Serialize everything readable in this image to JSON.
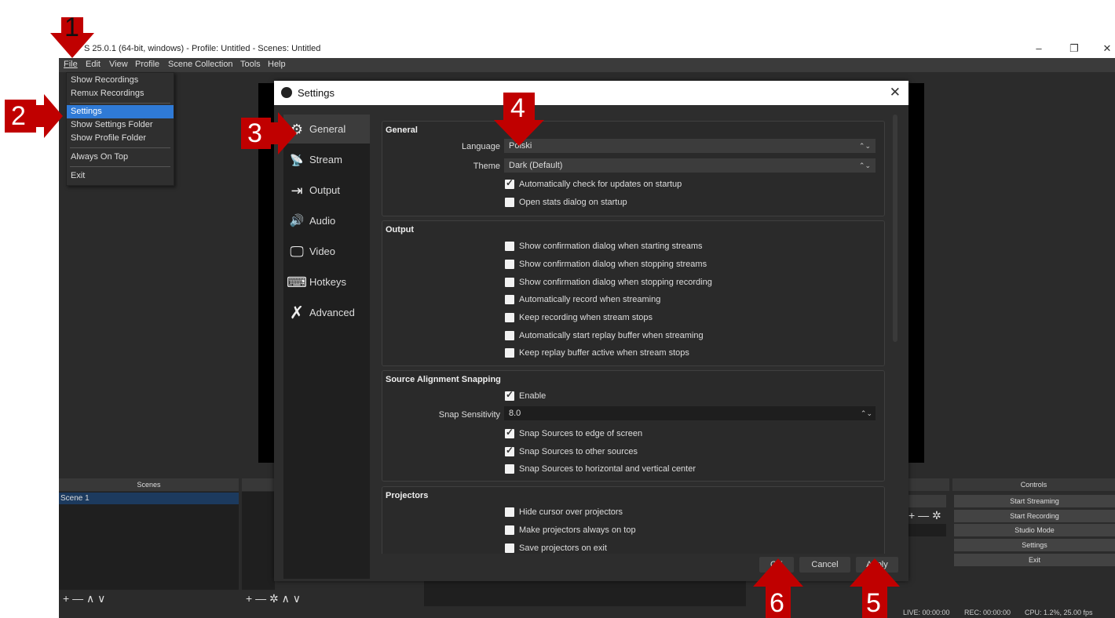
{
  "window": {
    "title": "OBS 25.0.1 (64-bit, windows) - Profile: Untitled - Scenes: Untitled",
    "title_visible": "S 25.0.1 (64-bit, windows) - Profile: Untitled - Scenes: Untitled",
    "min_btn": "–",
    "max_btn": "❐",
    "close_btn": "✕"
  },
  "menubar": [
    "File",
    "Edit",
    "View",
    "Profile",
    "Scene Collection",
    "Tools",
    "Help"
  ],
  "file_menu": {
    "items": [
      "Show Recordings",
      "Remux Recordings",
      "Settings",
      "Show Settings Folder",
      "Show Profile Folder",
      "Always On Top",
      "Exit"
    ],
    "selected": "Settings"
  },
  "docks": {
    "scenes_title": "Scenes",
    "scenes_items": [
      "Scene 1"
    ],
    "controls_title": "Controls",
    "controls_buttons": [
      "Start Streaming",
      "Start Recording",
      "Studio Mode",
      "Settings",
      "Exit"
    ],
    "scenes_footer": "+ — ∧ ∨",
    "sources_footer": "+ — ✲ ∧ ∨",
    "mixer_footer": "+ — ✲"
  },
  "status": {
    "live": "LIVE: 00:00:00",
    "rec": "REC: 00:00:00",
    "cpu": "CPU: 1.2%, 25.00 fps"
  },
  "settings": {
    "title": "Settings",
    "close": "✕",
    "categories": [
      {
        "label": "General",
        "icon": "gear-icon",
        "glyph": "⚙"
      },
      {
        "label": "Stream",
        "icon": "antenna-icon",
        "glyph": "📡"
      },
      {
        "label": "Output",
        "icon": "output-icon",
        "glyph": "⇥"
      },
      {
        "label": "Audio",
        "icon": "speaker-icon",
        "glyph": "🔊"
      },
      {
        "label": "Video",
        "icon": "monitor-icon",
        "glyph": "🖵"
      },
      {
        "label": "Hotkeys",
        "icon": "keyboard-icon",
        "glyph": "⌨"
      },
      {
        "label": "Advanced",
        "icon": "tools-icon",
        "glyph": "✗"
      }
    ],
    "general": {
      "title": "General",
      "language_label": "Language",
      "language_value": "Polski",
      "theme_label": "Theme",
      "theme_value": "Dark (Default)",
      "check_updates": "Automatically check for updates on startup",
      "open_stats": "Open stats dialog on startup"
    },
    "output": {
      "title": "Output",
      "items": [
        "Show confirmation dialog when starting streams",
        "Show confirmation dialog when stopping streams",
        "Show confirmation dialog when stopping recording",
        "Automatically record when streaming",
        "Keep recording when stream stops",
        "Automatically start replay buffer when streaming",
        "Keep replay buffer active when stream stops"
      ]
    },
    "snapping": {
      "title": "Source Alignment Snapping",
      "enable": "Enable",
      "sensitivity_label": "Snap Sensitivity",
      "sensitivity_value": "8.0",
      "edge": "Snap Sources to edge of screen",
      "other": "Snap Sources to other sources",
      "center": "Snap Sources to horizontal and vertical center"
    },
    "projectors": {
      "title": "Projectors",
      "items": [
        "Hide cursor over projectors",
        "Make projectors always on top",
        "Save projectors on exit"
      ]
    },
    "buttons": {
      "ok": "OK",
      "cancel": "Cancel",
      "apply": "Apply"
    }
  },
  "markers": [
    "1",
    "2",
    "3",
    "4",
    "5",
    "6"
  ],
  "colors": {
    "marker": "#c00000",
    "selection": "#2f7ad6",
    "background": "#2b2b2b"
  }
}
